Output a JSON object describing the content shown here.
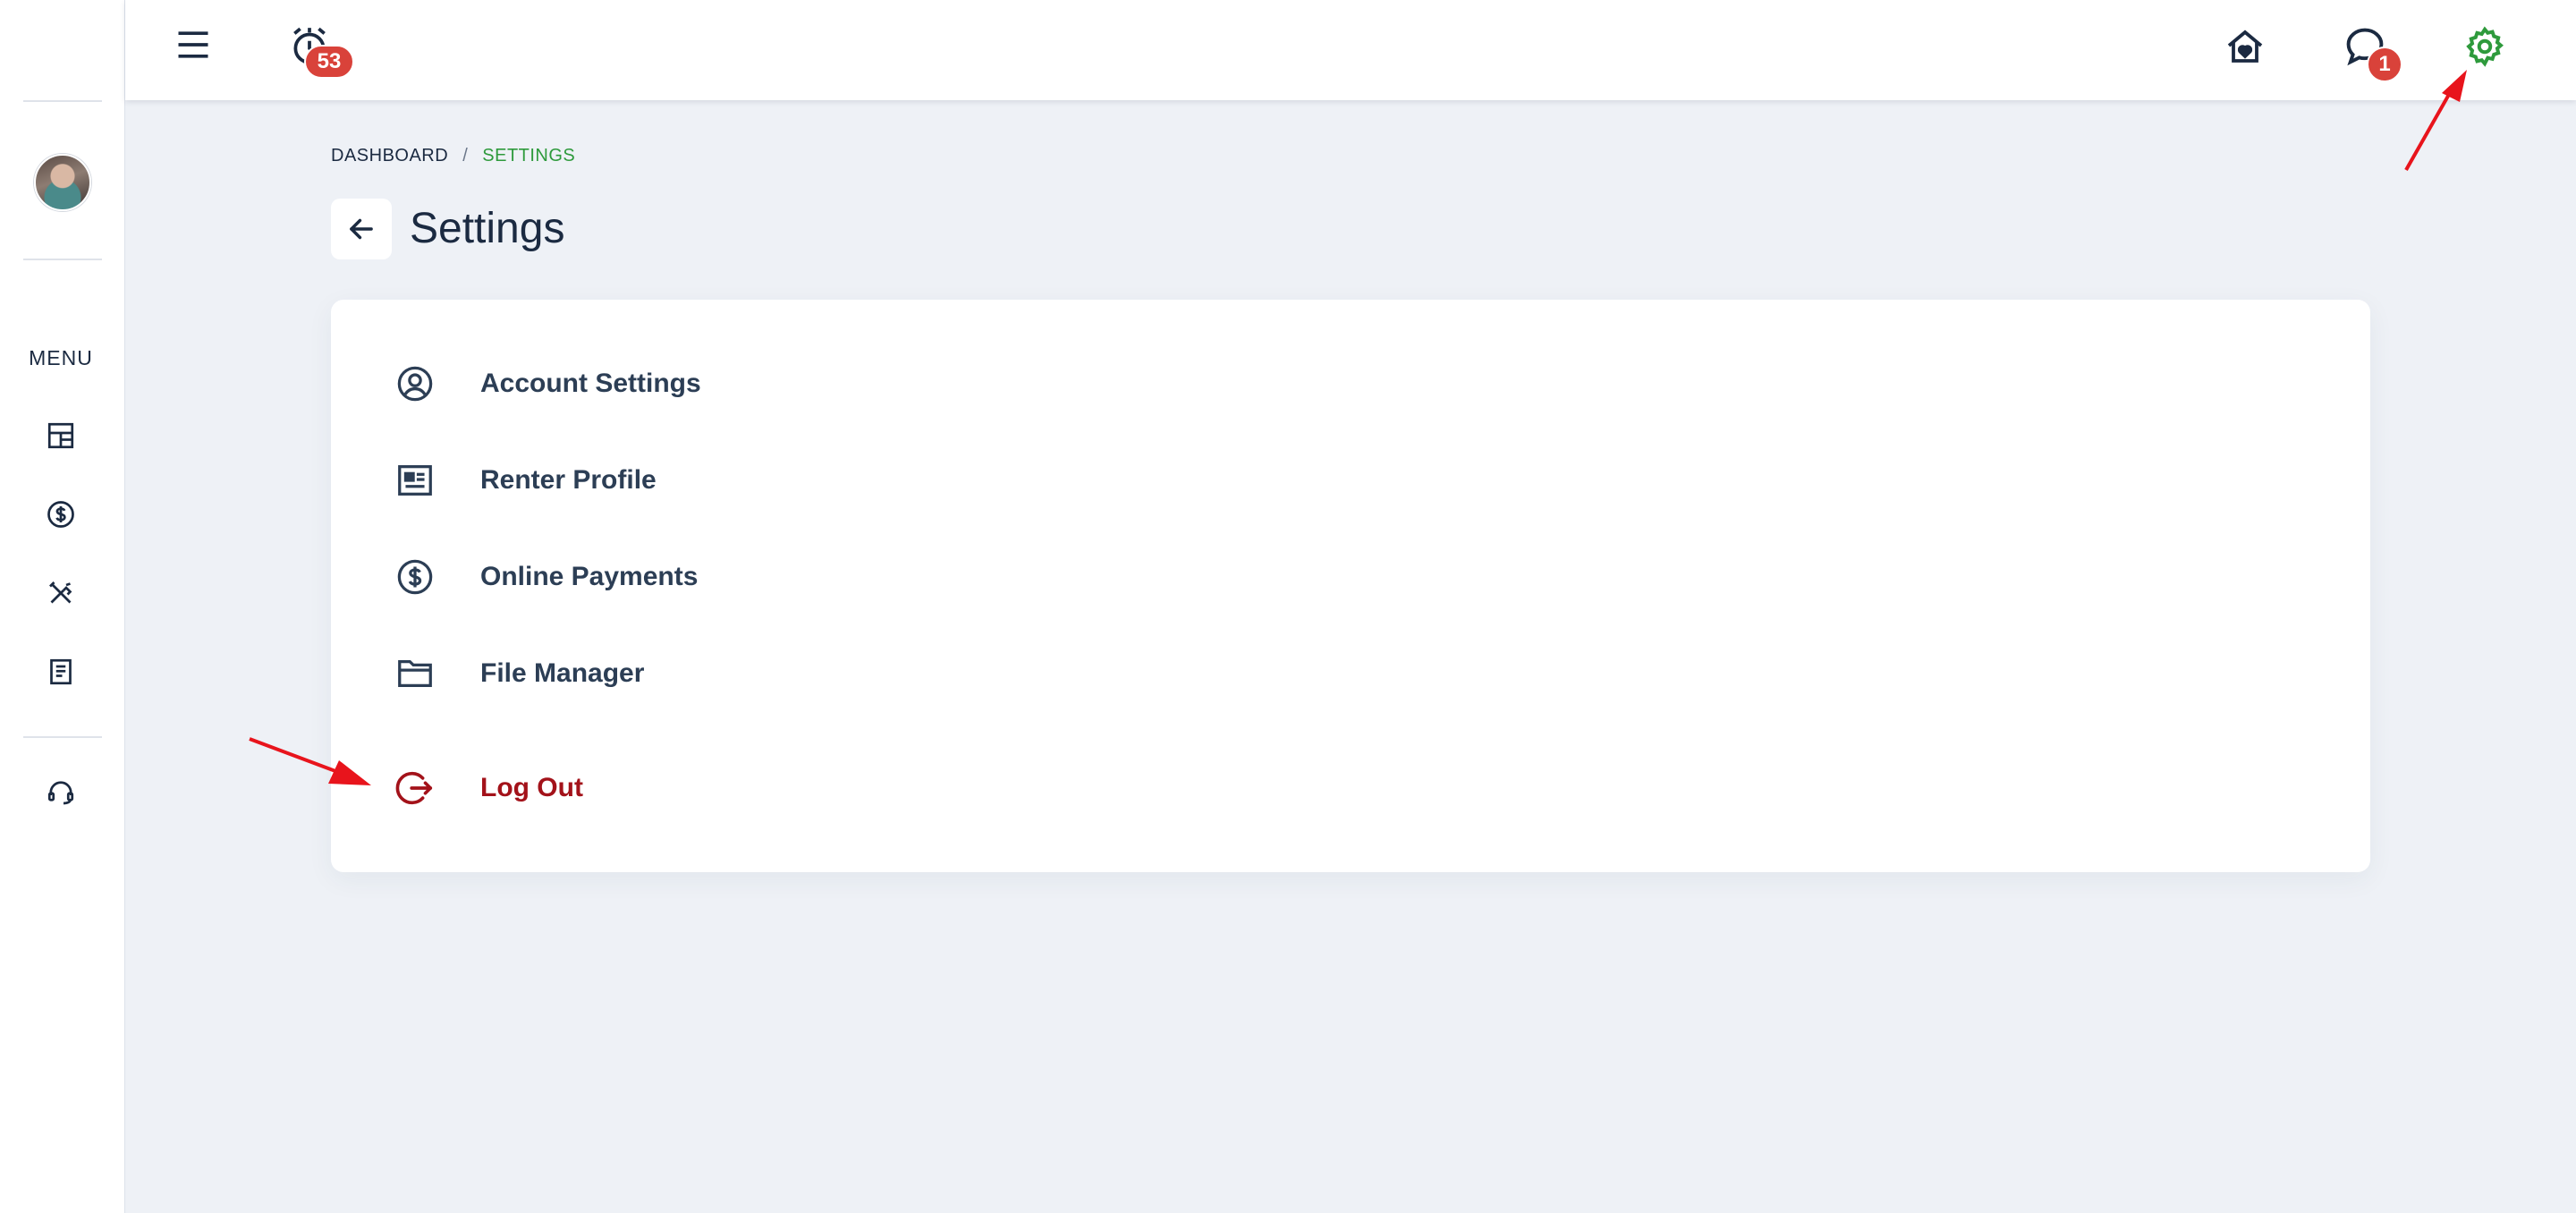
{
  "sidebar": {
    "menu_label": "MENU",
    "icons": [
      "dashboard-icon",
      "dollar-icon",
      "tools-icon",
      "document-icon",
      "support-headset-icon"
    ]
  },
  "topbar": {
    "notification_badge": "53",
    "messages_badge": "1",
    "active_color": "#2e9a3c"
  },
  "breadcrumb": {
    "home": "DASHBOARD",
    "separator": "/",
    "current": "SETTINGS"
  },
  "page": {
    "title": "Settings"
  },
  "settings_menu": {
    "items": [
      {
        "label": "Account Settings",
        "icon": "user-circle-icon"
      },
      {
        "label": "Renter Profile",
        "icon": "profile-card-icon"
      },
      {
        "label": "Online Payments",
        "icon": "dollar-circle-icon"
      },
      {
        "label": "File Manager",
        "icon": "folder-icon"
      }
    ],
    "logout": {
      "label": "Log Out",
      "icon": "logout-icon",
      "color": "#a3121a"
    }
  },
  "colors": {
    "text": "#1b2a41",
    "accent_green": "#2e9a3c",
    "badge_red": "#d9423a",
    "annotation_arrow": "#e8141c"
  }
}
